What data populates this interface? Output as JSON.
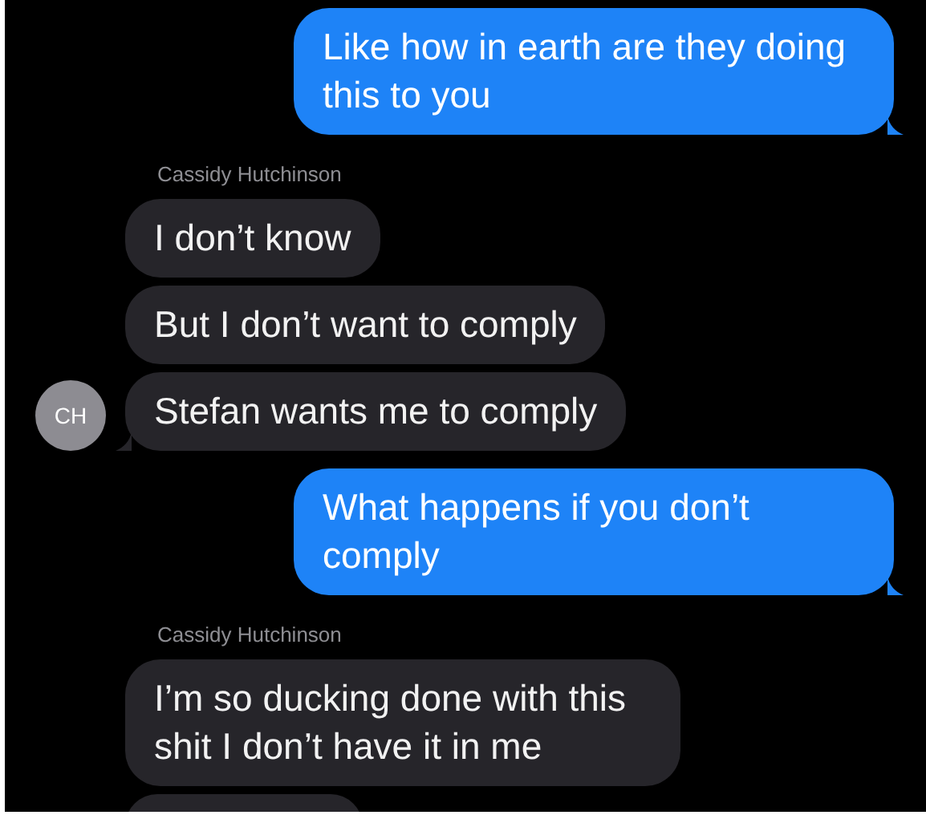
{
  "messages": [
    {
      "kind": "sent",
      "text": "Like how in earth are they doing this to you",
      "tail": true
    },
    {
      "kind": "name",
      "text": "Cassidy Hutchinson"
    },
    {
      "kind": "received",
      "text": "I don’t know",
      "tail": false
    },
    {
      "kind": "received",
      "text": "But I don’t want to comply",
      "tail": false
    },
    {
      "kind": "received",
      "text": "Stefan wants me to comply",
      "tail": true,
      "avatar": "CH"
    },
    {
      "kind": "sent",
      "text": "What happens if you don’t comply",
      "tail": true
    },
    {
      "kind": "name",
      "text": "Cassidy Hutchinson"
    },
    {
      "kind": "received",
      "text": "I’m so ducking done with this shit I don’t have it in me",
      "tail": false
    },
    {
      "kind": "partial"
    }
  ]
}
